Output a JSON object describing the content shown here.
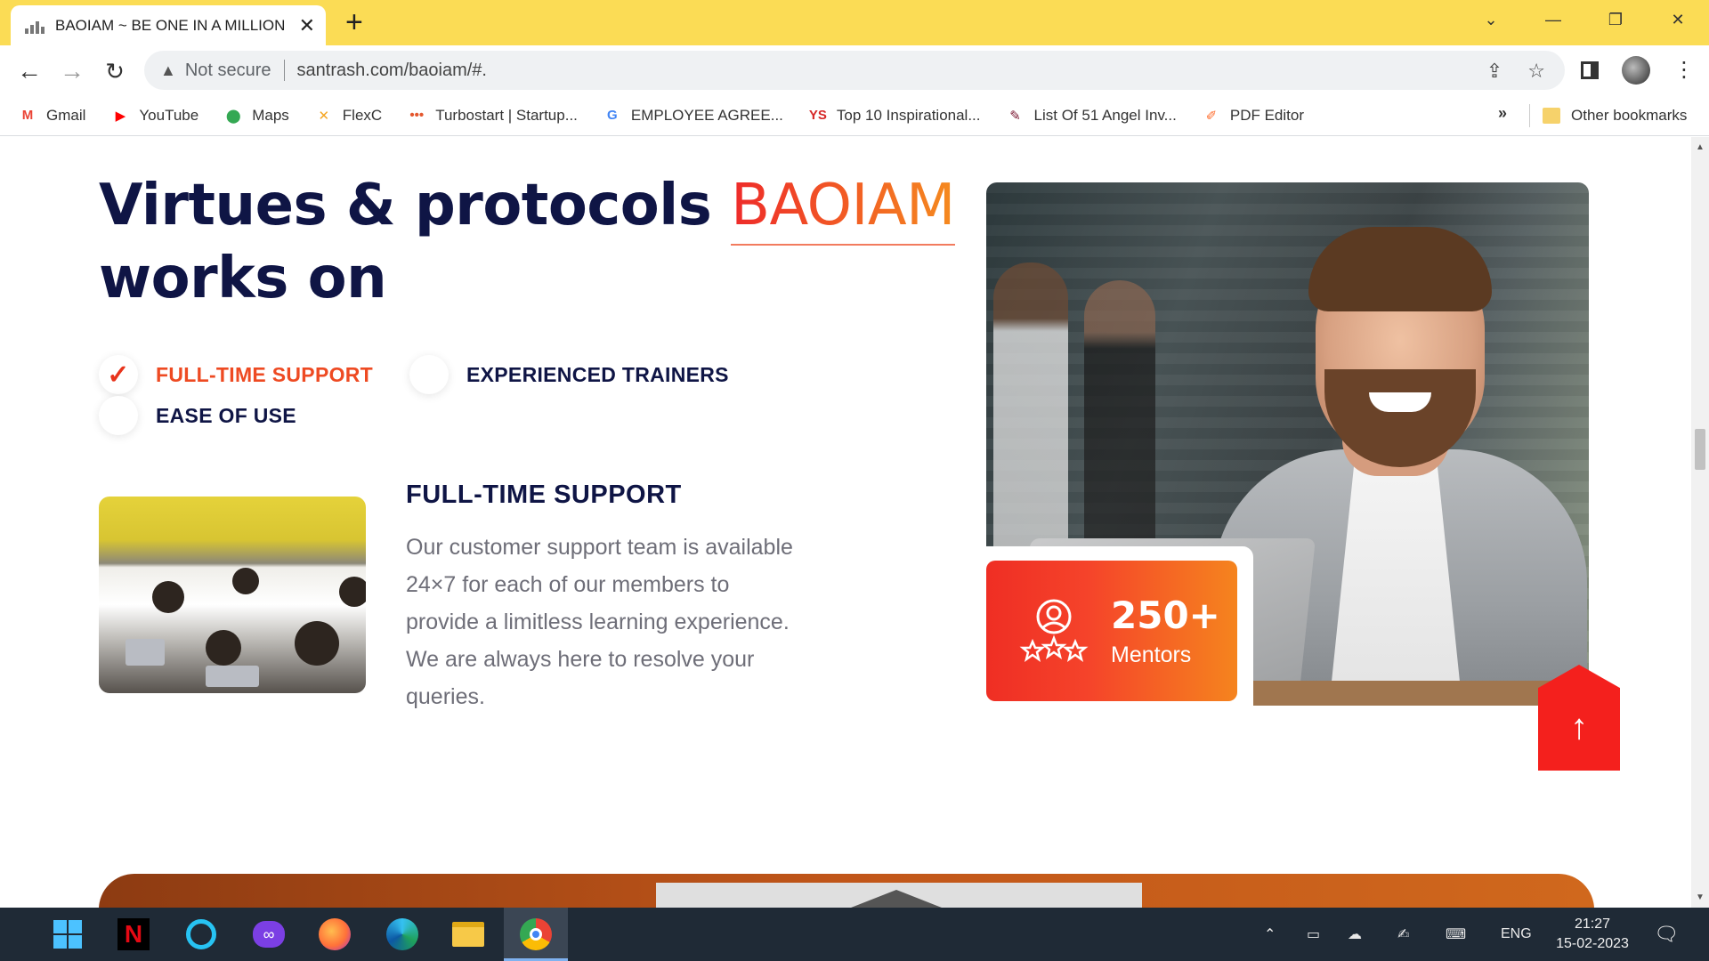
{
  "browser": {
    "tab_title": "BAOIAM ~ BE ONE IN A MILLION",
    "tab_close": "✕",
    "new_tab": "+",
    "security_label": "Not secure",
    "url": "santrash.com/baoiam/#.",
    "window_controls": {
      "minimize": "—",
      "restore": "❐",
      "close": "✕",
      "tab_search": "⌄"
    }
  },
  "bookmarks": [
    {
      "label": "Gmail",
      "icon": "gmail-icon",
      "glyph": "M",
      "color": "#ea4335"
    },
    {
      "label": "YouTube",
      "icon": "youtube-icon",
      "glyph": "▶",
      "color": "#ff0000"
    },
    {
      "label": "Maps",
      "icon": "maps-icon",
      "glyph": "⬤",
      "color": "#34a853"
    },
    {
      "label": "FlexC",
      "icon": "flexc-icon",
      "glyph": "✕",
      "color": "#f5a623"
    },
    {
      "label": "Turbostart | Startup...",
      "icon": "turbostart-icon",
      "glyph": "•••",
      "color": "#e4572e"
    },
    {
      "label": "EMPLOYEE AGREE...",
      "icon": "google-icon",
      "glyph": "G",
      "color": "#4285f4"
    },
    {
      "label": "Top 10 Inspirational...",
      "icon": "yourstory-icon",
      "glyph": "YS",
      "color": "#d62828"
    },
    {
      "label": "List Of 51 Angel Inv...",
      "icon": "list-icon",
      "glyph": "✎",
      "color": "#7a1630"
    },
    {
      "label": "PDF Editor",
      "icon": "pdf-editor-icon",
      "glyph": "✐",
      "color": "#ff6d2e"
    }
  ],
  "bookmarks_more": "»",
  "other_bookmarks": "Other bookmarks",
  "page": {
    "heading_part1": "Virtues & protocols ",
    "heading_brand": "BAOIAM",
    "heading_part2": "works on",
    "features": {
      "full_time": "FULL-TIME SUPPORT",
      "trainers": "EXPERIENCED TRAINERS",
      "ease": "EASE OF USE"
    },
    "detail_title": "FULL-TIME SUPPORT",
    "detail_text": "Our customer support team is available 24×7 for each of our members to provide a limitless learning experience. We are always here to resolve your queries.",
    "stat_value": "250+",
    "stat_label": "Mentors",
    "to_top": "↑"
  },
  "taskbar": {
    "language": "ENG",
    "time": "21:27",
    "date": "15-02-2023"
  }
}
